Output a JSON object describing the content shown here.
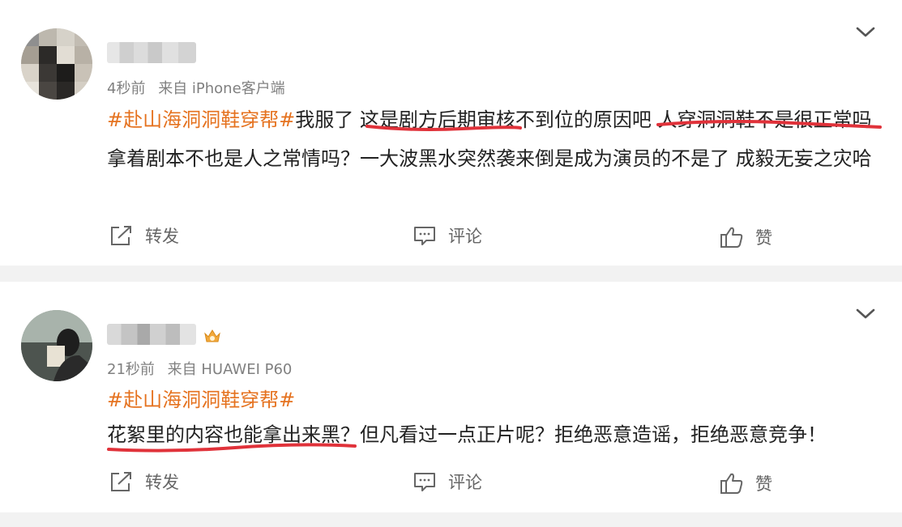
{
  "posts": [
    {
      "time": "4秒前",
      "source": "来自 iPhone客户端",
      "hashtag": "#赴山海洞洞鞋穿帮#",
      "text": "我服了 这是剧方后期审核不到位的原因吧 人穿洞洞鞋不是很正常吗 拿着剧本不也是人之常情吗？一大波黑水突然袭来倒是成为演员的不是了 成毅无妄之灾哈"
    },
    {
      "time": "21秒前",
      "source": "来自 HUAWEI P60",
      "hashtag": "#赴山海洞洞鞋穿帮#",
      "text": "花絮里的内容也能拿出来黑？但凡看过一点正片呢？拒绝恶意造谣，拒绝恶意竞争！"
    }
  ],
  "actions": {
    "repost_label": "转发",
    "comment_label": "评论",
    "like_label": "赞"
  },
  "icons": {
    "repost": "share-icon",
    "comment": "comment-icon",
    "like": "thumbs-up-icon",
    "expand": "chevron-down-icon",
    "badge": "crown-icon"
  },
  "colors": {
    "hashtag": "#e5721f",
    "underline": "#e0323a",
    "meta": "#808080",
    "background": "#f2f2f2"
  }
}
